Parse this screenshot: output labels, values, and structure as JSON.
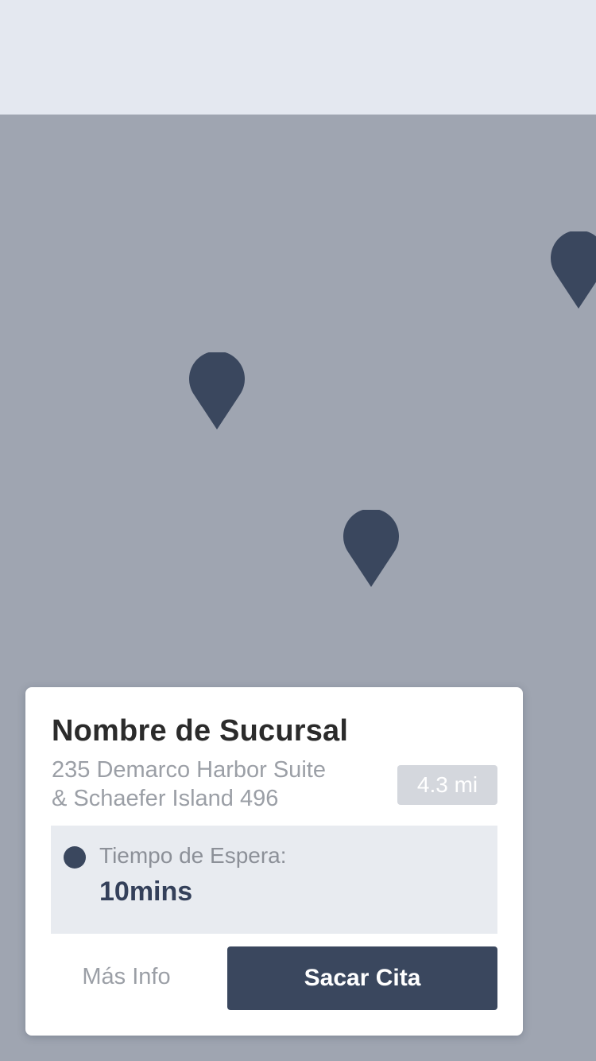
{
  "map": {
    "pin_color": "#3a475e",
    "pin_icon": "map-pin-icon"
  },
  "card": {
    "branch_name": "Nombre de Sucursal",
    "address_line1": "235 Demarco Harbor Suite",
    "address_line2": "& Schaefer Island 496",
    "distance": "4.3 mi",
    "wait": {
      "label": "Tiempo de Espera:",
      "value": "10mins",
      "status_color": "#3a475e"
    },
    "more_info_label": "Más Info",
    "appointment_label": "Sacar Cita"
  },
  "colors": {
    "header_bg": "#e4e8f0",
    "map_bg": "#9fa5b1",
    "accent": "#3a475e"
  }
}
